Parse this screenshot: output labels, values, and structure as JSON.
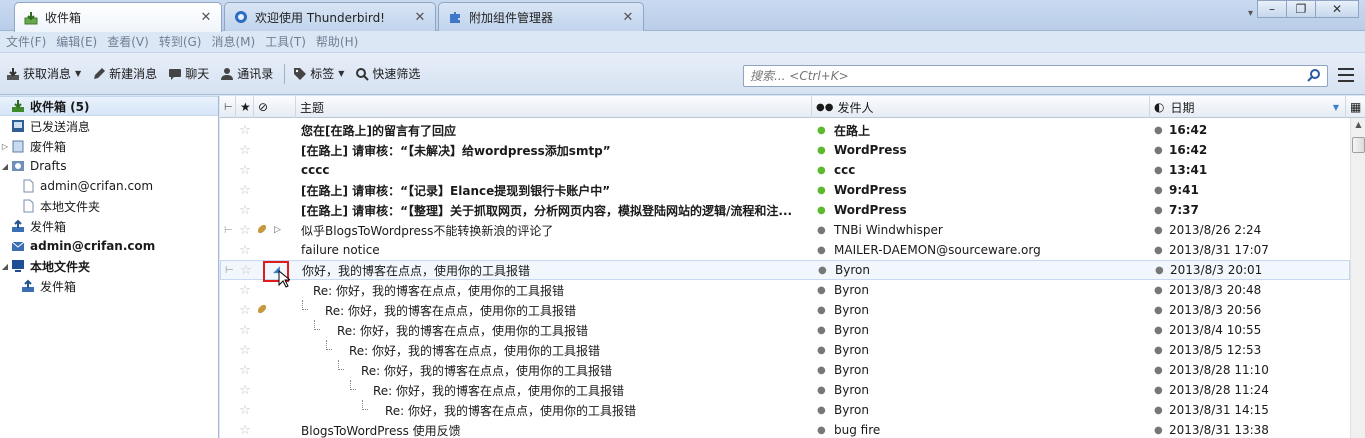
{
  "tabs": [
    {
      "label": "收件箱",
      "icon": "inbox-icon"
    },
    {
      "label": "欢迎使用 Thunderbird!",
      "icon": "thunderbird-icon"
    },
    {
      "label": "附加组件管理器",
      "icon": "puzzle-icon"
    }
  ],
  "menubar": [
    "文件(F)",
    "编辑(E)",
    "查看(V)",
    "转到(G)",
    "消息(M)",
    "工具(T)",
    "帮助(H)"
  ],
  "toolbar": {
    "get_messages": "获取消息",
    "new_message": "新建消息",
    "chat": "聊天",
    "address_book": "通讯录",
    "tags": "标签",
    "quick_filter": "快速筛选"
  },
  "search": {
    "placeholder": "搜索... <Ctrl+K>"
  },
  "folders": [
    {
      "label": "收件箱 (5)",
      "icon": "inbox-icon"
    },
    {
      "label": "已发送消息",
      "icon": "sent-icon"
    },
    {
      "label": "废件箱",
      "icon": "trash-icon"
    },
    {
      "label": "Drafts",
      "icon": "drafts-icon"
    },
    {
      "label": "admin@crifan.com",
      "icon": "folder-icon"
    },
    {
      "label": "本地文件夹",
      "icon": "folder-icon"
    },
    {
      "label": "发件箱",
      "icon": "outbox-icon"
    },
    {
      "label": "admin@crifan.com",
      "icon": "account-icon"
    },
    {
      "label": "本地文件夹",
      "icon": "local-folders-icon"
    },
    {
      "label": "发件箱",
      "icon": "outbox-icon"
    }
  ],
  "columns": {
    "subject": "主题",
    "sender": "发件人",
    "date": "日期"
  },
  "messages": [
    {
      "subject": "您在[在路上]的留言有了回应",
      "sender": "在路上",
      "date": "16:42",
      "unread": true
    },
    {
      "subject": "[在路上] 请审核：“【未解决】给wordpress添加smtp”",
      "sender": "WordPress",
      "date": "16:42",
      "unread": true
    },
    {
      "subject": "cccc",
      "sender": "ccc",
      "date": "13:41",
      "unread": true
    },
    {
      "subject": "[在路上] 请审核：“【记录】Elance提现到银行卡账户中”",
      "sender": "WordPress",
      "date": "9:41",
      "unread": true
    },
    {
      "subject": "[在路上] 请审核：“【整理】关于抓取网页，分析网页内容，模拟登陆网站的逻辑/流程和注...",
      "sender": "WordPress",
      "date": "7:37",
      "unread": true
    },
    {
      "subject": "似乎BlogsToWordpress不能转换新浪的评论了",
      "sender": "TNBi Windwhisper",
      "date": "2013/8/26 2:24",
      "unread": false
    },
    {
      "subject": "failure notice",
      "sender": "MAILER-DAEMON@sourceware.org",
      "date": "2013/8/31 17:07",
      "unread": false
    },
    {
      "subject": "你好，我的博客在点点，使用你的工具报错",
      "sender": "Byron",
      "date": "2013/8/3 20:01",
      "unread": false
    },
    {
      "subject": "Re: 你好，我的博客在点点，使用你的工具报错",
      "sender": "Byron",
      "date": "2013/8/3 20:48",
      "unread": false
    },
    {
      "subject": "Re: 你好，我的博客在点点，使用你的工具报错",
      "sender": "Byron",
      "date": "2013/8/3 20:56",
      "unread": false
    },
    {
      "subject": "Re: 你好，我的博客在点点，使用你的工具报错",
      "sender": "Byron",
      "date": "2013/8/4 10:55",
      "unread": false
    },
    {
      "subject": "Re: 你好，我的博客在点点，使用你的工具报错",
      "sender": "Byron",
      "date": "2013/8/5 12:53",
      "unread": false
    },
    {
      "subject": "Re: 你好，我的博客在点点，使用你的工具报错",
      "sender": "Byron",
      "date": "2013/8/28 11:10",
      "unread": false
    },
    {
      "subject": "Re: 你好，我的博客在点点，使用你的工具报错",
      "sender": "Byron",
      "date": "2013/8/28 11:24",
      "unread": false
    },
    {
      "subject": "Re: 你好，我的博客在点点，使用你的工具报错",
      "sender": "Byron",
      "date": "2013/8/31 14:15",
      "unread": false
    },
    {
      "subject": "BlogsToWordPress 使用反馈",
      "sender": "bug fire",
      "date": "2013/8/31 13:38",
      "unread": false
    }
  ],
  "colors": {
    "accent": "#3c7fd1",
    "unread_dot": "#5cb82c",
    "highlight_box": "#e01d1d"
  }
}
